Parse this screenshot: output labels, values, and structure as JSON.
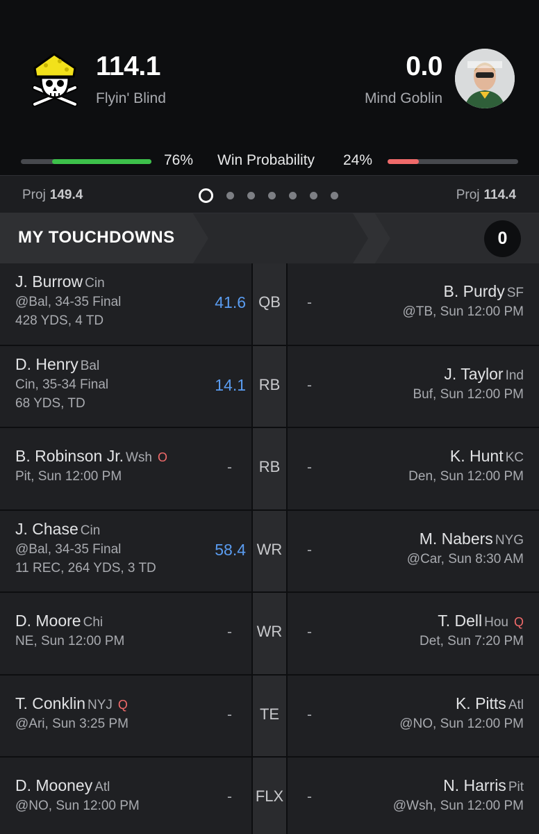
{
  "matchup": {
    "left": {
      "score": "114.1",
      "name": "Flyin' Blind",
      "proj_label": "Proj",
      "proj": "149.4",
      "win_pct": "76%",
      "win_fraction": 0.76
    },
    "right": {
      "score": "0.0",
      "name": "Mind Goblin",
      "proj_label": "Proj",
      "proj": "114.4",
      "win_pct": "24%",
      "win_fraction": 0.24
    },
    "win_label": "Win Probability"
  },
  "banner": {
    "title": "MY TOUCHDOWNS",
    "count": "0"
  },
  "pages": {
    "total": 7,
    "active": 0
  },
  "colors": {
    "accent_green": "#3dc04b",
    "accent_red": "#f06a6a",
    "points_blue": "#5a9cf0"
  },
  "rows": [
    {
      "pos": "QB",
      "left": {
        "name": "J. Burrow",
        "team": "Cin",
        "status": "",
        "line1": "@Bal, 34-35 Final",
        "line2": "428 YDS, 4 TD",
        "pts": "41.6"
      },
      "right": {
        "name": "B. Purdy",
        "team": "SF",
        "status": "",
        "line1": "@TB, Sun 12:00 PM",
        "pts": "-"
      }
    },
    {
      "pos": "RB",
      "left": {
        "name": "D. Henry",
        "team": "Bal",
        "status": "",
        "line1": "Cin, 35-34 Final",
        "line2": "68 YDS, TD",
        "pts": "14.1"
      },
      "right": {
        "name": "J. Taylor",
        "team": "Ind",
        "status": "",
        "line1": "Buf, Sun 12:00 PM",
        "pts": "-"
      }
    },
    {
      "pos": "RB",
      "left": {
        "name": "B. Robinson Jr.",
        "team": "Wsh",
        "status": "O",
        "line1": "Pit, Sun 12:00 PM",
        "line2": "",
        "pts": "-"
      },
      "right": {
        "name": "K. Hunt",
        "team": "KC",
        "status": "",
        "line1": "Den, Sun 12:00 PM",
        "pts": "-"
      }
    },
    {
      "pos": "WR",
      "left": {
        "name": "J. Chase",
        "team": "Cin",
        "status": "",
        "line1": "@Bal, 34-35 Final",
        "line2": "11 REC, 264 YDS, 3 TD",
        "pts": "58.4"
      },
      "right": {
        "name": "M. Nabers",
        "team": "NYG",
        "status": "",
        "line1": "@Car, Sun 8:30 AM",
        "pts": "-"
      }
    },
    {
      "pos": "WR",
      "left": {
        "name": "D. Moore",
        "team": "Chi",
        "status": "",
        "line1": "NE, Sun 12:00 PM",
        "line2": "",
        "pts": "-"
      },
      "right": {
        "name": "T. Dell",
        "team": "Hou",
        "status": "Q",
        "line1": "Det, Sun 7:20 PM",
        "pts": "-"
      }
    },
    {
      "pos": "TE",
      "left": {
        "name": "T. Conklin",
        "team": "NYJ",
        "status": "Q",
        "line1": "@Ari, Sun 3:25 PM",
        "line2": "",
        "pts": "-"
      },
      "right": {
        "name": "K. Pitts",
        "team": "Atl",
        "status": "",
        "line1": "@NO, Sun 12:00 PM",
        "pts": "-"
      }
    },
    {
      "pos": "FLX",
      "left": {
        "name": "D. Mooney",
        "team": "Atl",
        "status": "",
        "line1": "@NO, Sun 12:00 PM",
        "line2": "",
        "pts": "-"
      },
      "right": {
        "name": "N. Harris",
        "team": "Pit",
        "status": "",
        "line1": "@Wsh, Sun 12:00 PM",
        "pts": "-"
      }
    }
  ]
}
